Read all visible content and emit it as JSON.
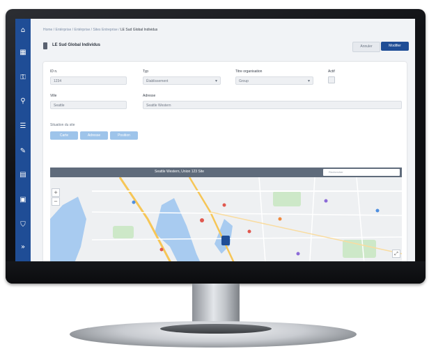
{
  "breadcrumb": {
    "items": [
      "Home",
      "Entérprise",
      "Entérprise / Sites Entreprise"
    ],
    "current": "LE Sud Global Individus"
  },
  "page": {
    "title": "LE Sud Global Individus"
  },
  "actions": {
    "cancel_label": "Annuler",
    "modify_label": "Modifier"
  },
  "form": {
    "fields": {
      "code": {
        "label": "ID n.",
        "value": "1234"
      },
      "type": {
        "label": "Typ",
        "value": "Établissement"
      },
      "org": {
        "label": "Titre organisation",
        "value": "Group"
      },
      "active": {
        "label": "Actif"
      },
      "city": {
        "label": "Ville",
        "value": "Seattle"
      },
      "address": {
        "label": "Adresse",
        "value": "Seattle Western"
      }
    },
    "location_label": "Situation du site",
    "location_buttons": [
      "Carte",
      "Adresse",
      "Position"
    ]
  },
  "map": {
    "title": "Seattle Western, Union 123 Site",
    "search_placeholder": "Rechercher"
  },
  "colors": {
    "sidebar": "#1f4d96",
    "accent": "#1f4d96",
    "water": "#a8cbf0",
    "land": "#eef0f2"
  },
  "sidebar_icons": [
    "home-icon",
    "building-icon",
    "key-icon",
    "search-icon",
    "list-icon",
    "wrench-icon",
    "document-icon",
    "clipboard-icon",
    "shield-icon",
    "chevron-right-icon"
  ]
}
